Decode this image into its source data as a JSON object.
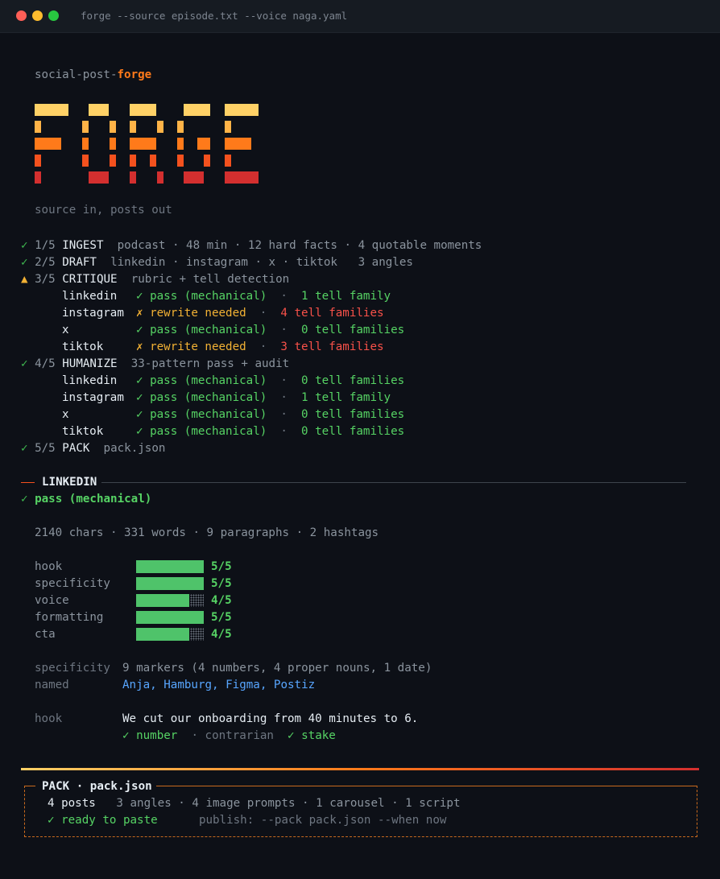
{
  "window": {
    "title": "forge --source episode.txt --voice naga.yaml"
  },
  "brand": {
    "prefix": "social-post-",
    "highlight": "forge"
  },
  "tagline": "source in, posts out",
  "colors": {
    "accent": "#ff7a1a",
    "ok": "#3fb950",
    "warn": "#f2b134",
    "error": "#f85149"
  },
  "steps": {
    "ingest": {
      "mark": "✓",
      "num": "1/5",
      "name": "INGEST",
      "detail": "podcast · 48 min · 12 hard facts · 4 quotable moments"
    },
    "draft": {
      "mark": "✓",
      "num": "2/5",
      "name": "DRAFT",
      "detail": "linkedin · instagram · x · tiktok   3 angles"
    },
    "critique": {
      "mark": "▲",
      "num": "3/5",
      "name": "CRITIQUE",
      "detail": "rubric + tell detection",
      "rows": [
        {
          "platform": "linkedin",
          "mark": "✓",
          "status": "pass (mechanical)",
          "sep": "·",
          "count": "1 tell family"
        },
        {
          "platform": "instagram",
          "mark": "✗",
          "status": "rewrite needed",
          "sep": "·",
          "count": "4 tell families"
        },
        {
          "platform": "x",
          "mark": "✓",
          "status": "pass (mechanical)",
          "sep": "·",
          "count": "0 tell families"
        },
        {
          "platform": "tiktok",
          "mark": "✗",
          "status": "rewrite needed",
          "sep": "·",
          "count": "3 tell families"
        }
      ]
    },
    "humanize": {
      "mark": "✓",
      "num": "4/5",
      "name": "HUMANIZE",
      "detail": "33-pattern pass + audit",
      "rows": [
        {
          "platform": "linkedin",
          "mark": "✓",
          "status": "pass (mechanical)",
          "sep": "·",
          "count": "0 tell families"
        },
        {
          "platform": "instagram",
          "mark": "✓",
          "status": "pass (mechanical)",
          "sep": "·",
          "count": "1 tell family"
        },
        {
          "platform": "x",
          "mark": "✓",
          "status": "pass (mechanical)",
          "sep": "·",
          "count": "0 tell families"
        },
        {
          "platform": "tiktok",
          "mark": "✓",
          "status": "pass (mechanical)",
          "sep": "·",
          "count": "0 tell families"
        }
      ]
    },
    "pack": {
      "mark": "✓",
      "num": "5/5",
      "name": "PACK",
      "detail": "pack.json"
    }
  },
  "linkedin": {
    "section": "LINKEDIN",
    "verdict_mark": "✓",
    "verdict": "pass (mechanical)",
    "stats": "2140 chars · 331 words · 9 paragraphs · 2 hashtags",
    "rubric": [
      {
        "label": "hook",
        "score": "5/5",
        "value": 5,
        "max": 5
      },
      {
        "label": "specificity",
        "score": "5/5",
        "value": 5,
        "max": 5
      },
      {
        "label": "voice",
        "score": "4/5",
        "value": 4,
        "max": 5
      },
      {
        "label": "formatting",
        "score": "5/5",
        "value": 5,
        "max": 5
      },
      {
        "label": "cta",
        "score": "4/5",
        "value": 4,
        "max": 5
      }
    ],
    "specificity_label": "specificity",
    "specificity_value": "9 markers (4 numbers, 4 proper nouns, 1 date)",
    "named_label": "named",
    "named_value": "Anja, Hamburg, Figma, Postiz",
    "hook_label": "hook",
    "hook_text": "We cut our onboarding from 40 minutes to 6.",
    "hook_tags": [
      {
        "mark": "✓",
        "label": "number",
        "hit": true
      },
      {
        "mark": "·",
        "label": "contrarian",
        "hit": false
      },
      {
        "mark": "✓",
        "label": "stake",
        "hit": true
      }
    ]
  },
  "pack": {
    "title": "PACK · pack.json",
    "posts": "4 posts",
    "summary": "3 angles · 4 image prompts · 1 carousel · 1 script",
    "ready_mark": "✓",
    "ready": "ready to paste",
    "publish": "publish: --pack pack.json --when now"
  }
}
